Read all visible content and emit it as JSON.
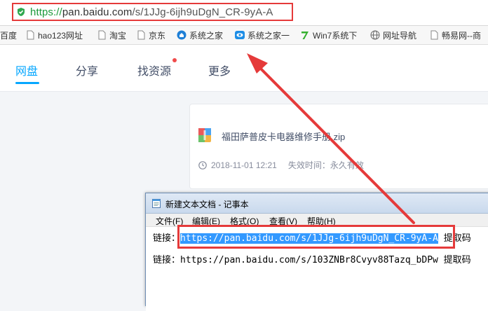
{
  "browser": {
    "url_scheme": "https://",
    "url_host": "pan.baidu.com",
    "url_path": "/s/1JJg-6ijh9uDgN_CR-9yA-A"
  },
  "bookmarks": [
    {
      "label": "百度",
      "icon": "baidu-icon"
    },
    {
      "label": "hao123网址",
      "icon": "page-icon"
    },
    {
      "label": "淘宝",
      "icon": "page-icon"
    },
    {
      "label": "京东",
      "icon": "page-icon"
    },
    {
      "label": "系统之家",
      "icon": "system-home-icon"
    },
    {
      "label": "系统之家一",
      "icon": "eye-icon"
    },
    {
      "label": "Win7系统下",
      "icon": "seven-icon"
    },
    {
      "label": "网址导航",
      "icon": "globe-icon"
    },
    {
      "label": "畅易网--商",
      "icon": "page-icon"
    }
  ],
  "nav": {
    "tabs": [
      "网盘",
      "分享",
      "找资源",
      "更多"
    ],
    "active_color": "#06a7ff"
  },
  "share": {
    "file_name": "福田萨普皮卡电器维修手册.zip",
    "date": "2018-11-01 12:21",
    "expiry": "失效时间：永久有效"
  },
  "notepad": {
    "title": "新建文本文档 - 记事本",
    "menu": [
      "文件(F)",
      "编辑(E)",
      "格式(O)",
      "查看(V)",
      "帮助(H)"
    ],
    "line1_prefix": "链接：",
    "line1_link": "https://pan.baidu.com/s/1JJg-6ijh9uDgN_CR-9yA-A",
    "line1_suffix": " 提取码",
    "line2": "链接：https://pan.baidu.com/s/103ZNBr8Cvyv88Tazq_bDPw 提取码"
  },
  "colors": {
    "highlight": "#e53a3a",
    "selection": "#3399ff"
  }
}
